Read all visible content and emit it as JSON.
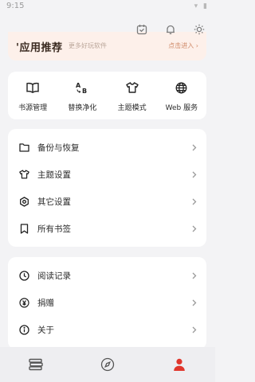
{
  "status_bar": {
    "time": "9:15",
    "system": "▾ ▮"
  },
  "top_icons": [
    "calendar-icon",
    "bell-icon",
    "sun-icon"
  ],
  "promo": {
    "title": "'应用推荐",
    "subtitle": "更多好玩软件",
    "cta": "点击进入 ›"
  },
  "quick_actions": [
    {
      "label": "书源管理",
      "icon": "book-open-icon"
    },
    {
      "label": "替换净化",
      "icon": "replace-icon"
    },
    {
      "label": "主题模式",
      "icon": "shirt-icon"
    },
    {
      "label": "Web 服务",
      "icon": "globe-icon"
    }
  ],
  "settings_list": [
    {
      "label": "备份与恢复",
      "icon": "folder-icon"
    },
    {
      "label": "主题设置",
      "icon": "shirt-icon"
    },
    {
      "label": "其它设置",
      "icon": "gear-icon"
    },
    {
      "label": "所有书签",
      "icon": "bookmark-icon"
    }
  ],
  "more_list": [
    {
      "label": "阅读记录",
      "icon": "clock-icon"
    },
    {
      "label": "捐赠",
      "icon": "yuan-icon"
    },
    {
      "label": "关于",
      "icon": "info-icon"
    }
  ],
  "bottom_nav": [
    {
      "icon": "bookshelf-icon",
      "active": false
    },
    {
      "icon": "compass-icon",
      "active": false
    },
    {
      "icon": "person-icon",
      "active": true
    }
  ],
  "colors": {
    "accent": "#e0362c",
    "icon_gray": "#7a7a7a",
    "promo_bg": "#fdf0ea"
  }
}
